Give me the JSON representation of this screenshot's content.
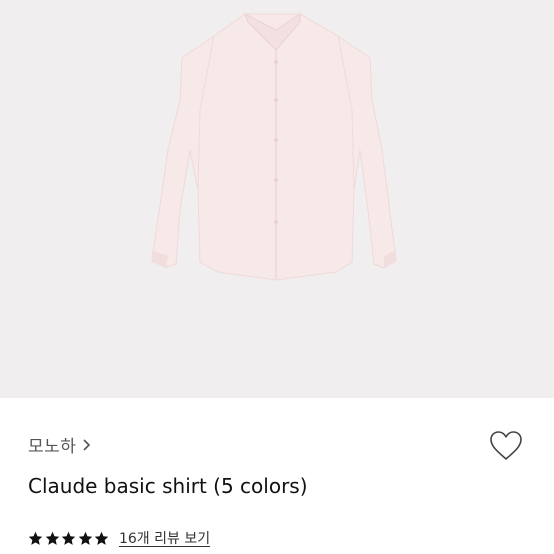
{
  "product": {
    "image_alt": "pink long-sleeve button-up shirt",
    "background_color": "#f0eeee",
    "shirt_color": "#f6e6e6"
  },
  "brand": {
    "name": "모노하",
    "chevron": "chevron-right-icon"
  },
  "title": "Claude basic shirt (5 colors)",
  "wishlist": {
    "icon": "heart-outline-icon"
  },
  "rating": {
    "stars": 5,
    "max_stars": 5,
    "star_icon": "star-filled-icon",
    "review_link": "16개 리뷰 보기"
  }
}
